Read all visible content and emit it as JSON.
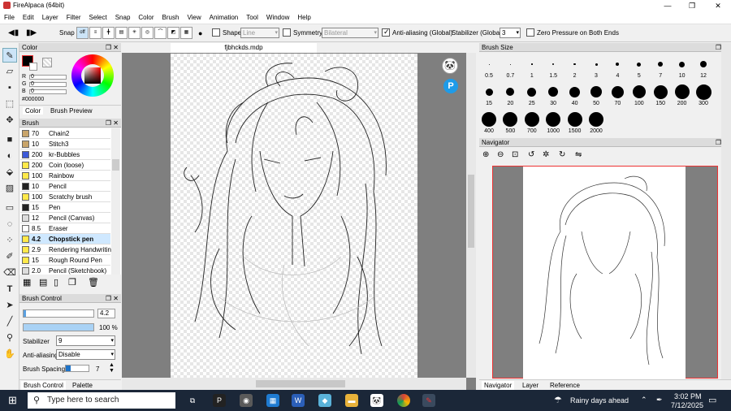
{
  "window": {
    "title": "FireAlpaca (64bit)"
  },
  "menu": [
    "File",
    "Edit",
    "Layer",
    "Filter",
    "Select",
    "Snap",
    "Color",
    "Brush",
    "View",
    "Animation",
    "Tool",
    "Window",
    "Help"
  ],
  "toolbar": {
    "snap_label": "Snap",
    "snap_off": "off",
    "shape_label": "Shape",
    "shape_value": "Line",
    "symmetry_label": "Symmetry",
    "symmetry_value": "Bilateral",
    "antialias_label": "Anti-aliasing (Global)",
    "stabilizer_label": "Stabilizer (Global)",
    "stabilizer_value": "3",
    "zero_pressure_label": "Zero Pressure on Both Ends"
  },
  "color_panel": {
    "title": "Color",
    "r_label": "R",
    "r_value": "0",
    "g_label": "G",
    "g_value": "0",
    "b_label": "B",
    "b_value": "0",
    "hex": "#000000",
    "tab_color": "Color",
    "tab_preview": "Brush Preview",
    "primary_color": "#000000"
  },
  "brush_panel": {
    "title": "Brush",
    "items": [
      {
        "size": "70",
        "name": "Chain2",
        "color": "#c8a46a"
      },
      {
        "size": "10",
        "name": "Stitch3",
        "color": "#c8a46a"
      },
      {
        "size": "200",
        "name": "kr-Bubbles",
        "color": "#3d5ad8"
      },
      {
        "size": "200",
        "name": "Coin (loose)",
        "color": "#ffe94a"
      },
      {
        "size": "100",
        "name": "Rainbow",
        "color": "#ffe94a"
      },
      {
        "size": "10",
        "name": "Pencil",
        "color": "#222222"
      },
      {
        "size": "100",
        "name": "Scratchy brush",
        "color": "#ffe94a"
      },
      {
        "size": "15",
        "name": "Pen",
        "color": "#222222"
      },
      {
        "size": "12",
        "name": "Pencil (Canvas)",
        "color": "#dddddd"
      },
      {
        "size": "8.5",
        "name": "Eraser",
        "color": "#ffffff"
      },
      {
        "size": "4.2",
        "name": "Chopstick pen",
        "color": "#ffe94a"
      },
      {
        "size": "2.9",
        "name": "Rendering Handwriting",
        "color": "#ffe94a"
      },
      {
        "size": "15",
        "name": "Rough Round Pen",
        "color": "#ffe94a"
      },
      {
        "size": "2.0",
        "name": "Pencil (Sketchbook)",
        "color": "#dddddd"
      }
    ]
  },
  "brush_control": {
    "title": "Brush Control",
    "size_value": "4.2",
    "opacity_value": "100 %",
    "stabilizer_label": "Stabilizer",
    "stabilizer_value": "9",
    "antialias_label": "Anti-aliasing",
    "antialias_value": "Disable",
    "spacing_label": "Brush Spacing",
    "spacing_value": "7",
    "tab_control": "Brush Control",
    "tab_palette": "Palette"
  },
  "canvas": {
    "tab_title": "fjbhckds.mdp"
  },
  "brush_size_panel": {
    "title": "Brush Size",
    "sizes": [
      "0.5",
      "0.7",
      "1",
      "1.5",
      "2",
      "3",
      "4",
      "5",
      "7",
      "10",
      "12",
      "15",
      "20",
      "25",
      "30",
      "40",
      "50",
      "70",
      "100",
      "150",
      "200",
      "300",
      "400",
      "500",
      "700",
      "1000",
      "1500",
      "2000"
    ]
  },
  "navigator": {
    "title": "Navigator",
    "tab_navigator": "Navigator",
    "tab_layer": "Layer",
    "tab_reference": "Reference"
  },
  "taskbar": {
    "search_placeholder": "Type here to search",
    "weather": "Rainy days ahead",
    "time": "3:02 PM",
    "date": "7/12/2025"
  }
}
